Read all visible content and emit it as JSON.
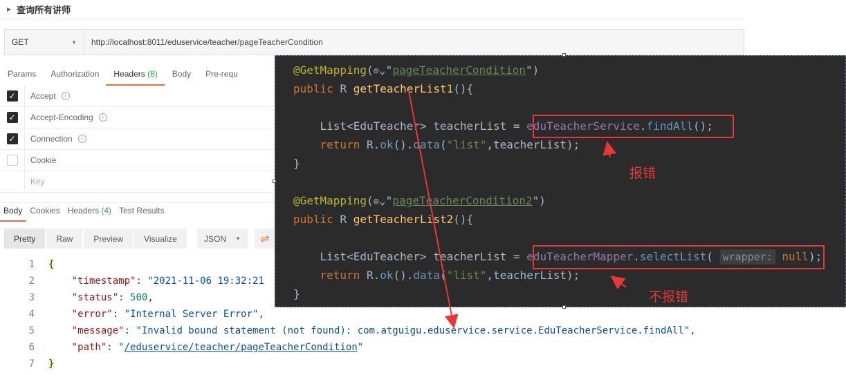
{
  "request": {
    "title": "查询所有讲师",
    "method": "GET",
    "url": "http://localhost:8011/eduservice/teacher/pageTeacherCondition"
  },
  "request_tabs": [
    {
      "label": "Params"
    },
    {
      "label": "Authorization"
    },
    {
      "label": "Headers",
      "count": "(8)"
    },
    {
      "label": "Body"
    },
    {
      "label": "Pre-requ"
    }
  ],
  "headers": [
    {
      "key": "Accept",
      "checked": true
    },
    {
      "key": "Accept-Encoding",
      "checked": true
    },
    {
      "key": "Connection",
      "checked": true
    },
    {
      "key": "Cookie",
      "checked": false
    },
    {
      "key": "Key",
      "checked": false
    }
  ],
  "response_tabs": [
    {
      "label": "Body"
    },
    {
      "label": "Cookies"
    },
    {
      "label": "Headers",
      "count": "(4)"
    },
    {
      "label": "Test Results"
    }
  ],
  "view_modes": [
    "Pretty",
    "Raw",
    "Preview",
    "Visualize"
  ],
  "format": "JSON",
  "json_lines": {
    "n1": "1",
    "n2": "2",
    "n3": "3",
    "n4": "4",
    "n5": "5",
    "n6": "6",
    "n7": "7",
    "open": "{",
    "close": "}",
    "timestamp_key": "\"timestamp\"",
    "timestamp_val": "\"2021-11-06 19:32:21",
    "status_key": "\"status\"",
    "status_val": "500",
    "error_key": "\"error\"",
    "error_val": "\"Internal Server Error\"",
    "message_key": "\"message\"",
    "message_val": "\"Invalid bound statement (not found): com.atguigu.eduservice.service.EduTeacherService.findAll\"",
    "path_key": "\"path\"",
    "path_q1": "\"",
    "path_val": "/eduservice/teacher/pageTeacherCondition",
    "path_q2": "\""
  },
  "ide": {
    "ann1": "@GetMapping",
    "globe": "⊕",
    "str1": "pageTeacherCondition",
    "kw_public": "public",
    "type_r": "R",
    "fn1": "getTeacherList1",
    "list_decl": "List<EduTeacher> teacherList = ",
    "svc_field": "eduTeacherService",
    "svc_call": "findAll",
    "kw_return": "return",
    "ok": "ok",
    "data_fn": "data",
    "list_str": "\"list\"",
    "list_arg": "teacherList",
    "close_brace": "}",
    "str2": "pageTeacherCondition2",
    "fn2": "getTeacherList2",
    "mapper_field": "eduTeacherMapper",
    "mapper_call": "selectList",
    "hint": "wrapper:",
    "null_kw": "null"
  },
  "annotations": {
    "error": "报错",
    "no_error": "不报错"
  },
  "colors": {
    "annotation_red": "#e53935",
    "postman_orange": "#f26b3a",
    "ide_bg": "#2b2b2b"
  }
}
